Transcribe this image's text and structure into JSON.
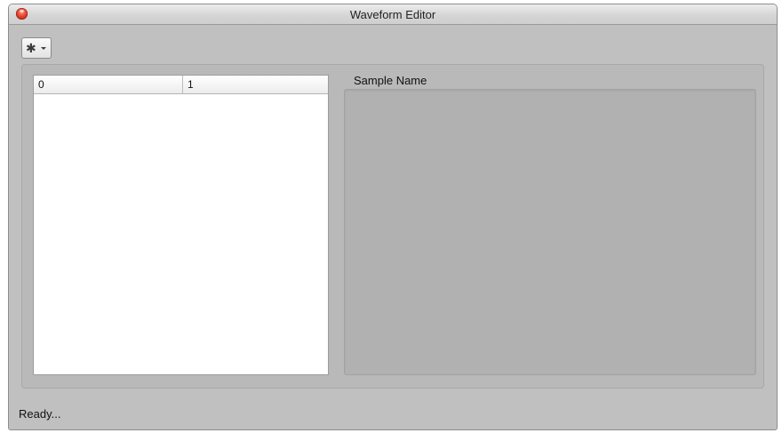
{
  "window": {
    "title": "Waveform Editor"
  },
  "toolbar": {
    "action_menu_icon": "gear-icon"
  },
  "table": {
    "columns": [
      "0",
      "1"
    ]
  },
  "sample_panel": {
    "label": "Sample Name"
  },
  "status": {
    "text": "Ready..."
  }
}
